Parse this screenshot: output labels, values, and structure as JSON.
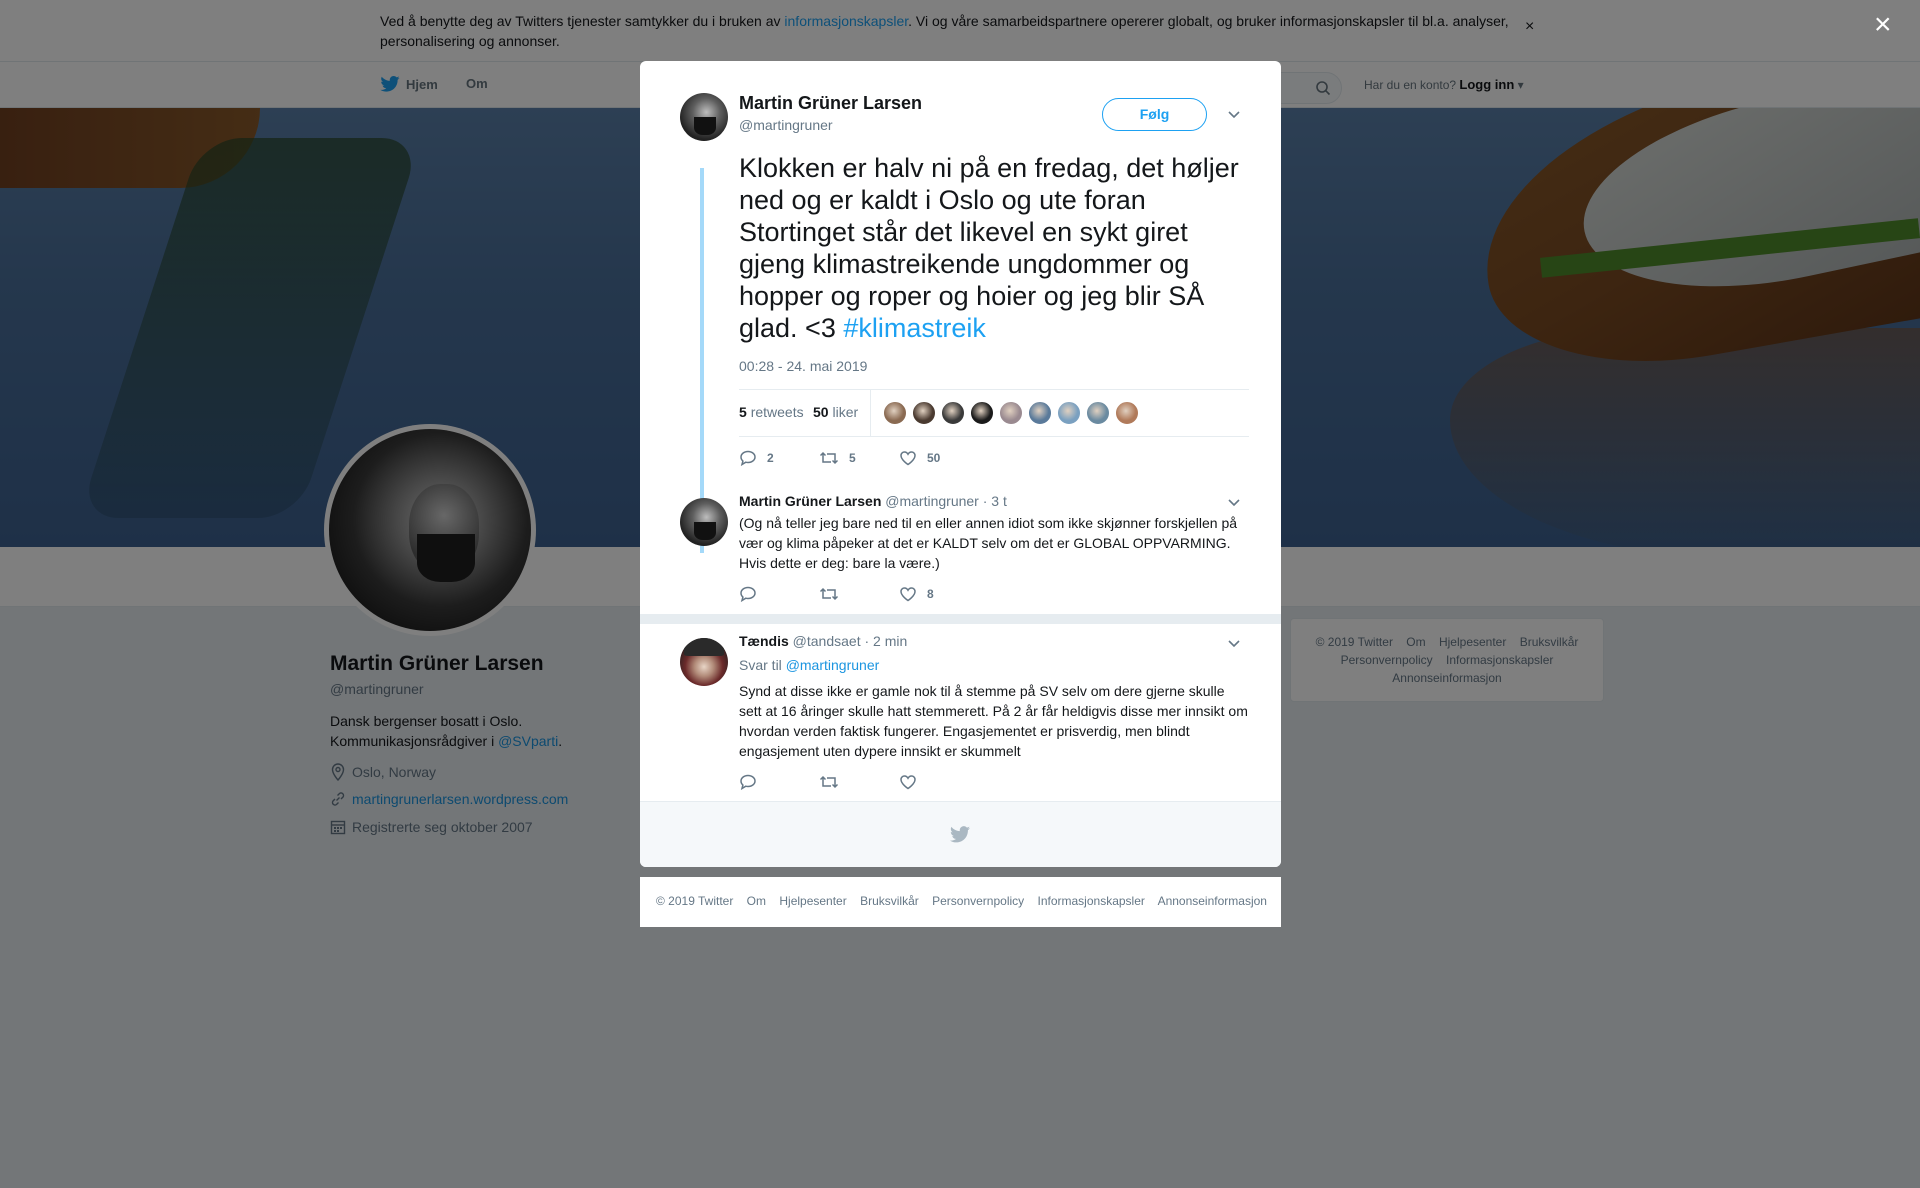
{
  "cookie": {
    "text_before": "Ved å benytte deg av Twitters tjenester samtykker du i bruken av ",
    "link": "informasjonskapsler",
    "text_after": ". Vi og våre samarbeidspartnere opererer globalt, og bruker informasjonskapsler til bl.a. analyser, personalisering og annonser.",
    "close": "×"
  },
  "nav": {
    "home": "Hjem",
    "about": "Om",
    "have_account": "Har du en konto?",
    "login": "Logg inn"
  },
  "profile": {
    "name": "Martin Grüner Larsen",
    "handle": "@martingruner",
    "bio_before": "Dansk bergenser bosatt i Oslo. Kommunikasjonsrådgiver i ",
    "bio_link": "@SVparti",
    "bio_after": ".",
    "location": "Oslo, Norway",
    "website": "martingrunerlarsen.wordpress.com",
    "joined": "Registrerte seg oktober 2007"
  },
  "side_footer": {
    "copyright": "© 2019 Twitter",
    "links": [
      "Om",
      "Hjelpesenter",
      "Bruksvilkår",
      "Personvernpolicy",
      "Informasjonskapsler",
      "Annonseinformasjon"
    ]
  },
  "overlay_close": "×",
  "tweet": {
    "name": "Martin Grüner Larsen",
    "handle": "@martingruner",
    "follow": "Følg",
    "text": "Klokken er halv ni på en fredag, det høljer ned og er kaldt i Oslo og ute foran Stortinget står det likevel en sykt giret gjeng klimastreikende ungdommer og hopper og roper og hoier og jeg blir SÅ glad. <3 ",
    "hashtag": "#klimastreik",
    "time": "00:28 - 24. mai 2019",
    "retweets_count": "5",
    "retweets_label": "retweets",
    "likes_count": "50",
    "likes_label": "liker",
    "liker_colors": [
      "#8a6a52",
      "#4a3a30",
      "#3a3a3a",
      "#1a1a1a",
      "#9a8a90",
      "#5a7a9a",
      "#7aa0c0",
      "#6a8aa0",
      "#b07a5a"
    ],
    "actions": {
      "replies": "2",
      "retweets": "5",
      "likes": "50"
    }
  },
  "replies": [
    {
      "name": "Martin Grüner Larsen",
      "handle": "@martingruner",
      "time": "· 3 t",
      "text": "(Og nå teller jeg bare ned til en eller annen idiot som ikke skjønner forskjellen på vær og klima påpeker at det er KALDT selv om det er GLOBAL OPPVARMING. Hvis dette er deg: bare la være.)",
      "likes": "8"
    },
    {
      "name": "Tændis",
      "handle": "@tandsaet",
      "time": "· 2 min",
      "reply_to_label": "Svar til",
      "reply_to_link": "@martingruner",
      "text": "Synd at disse ikke er gamle nok til å stemme på SV selv om dere gjerne skulle sett at 16 åringer skulle hatt stemmerett. På 2 år får heldigvis disse mer innsikt om hvordan verden faktisk fungerer. Engasjementet er prisverdig, men blindt engasjement uten dypere innsikt er skummelt"
    }
  ],
  "bottom_footer": {
    "copyright": "© 2019 Twitter",
    "links": [
      "Om",
      "Hjelpesenter",
      "Bruksvilkår",
      "Personvernpolicy",
      "Informasjonskapsler",
      "Annonseinformasjon"
    ]
  }
}
